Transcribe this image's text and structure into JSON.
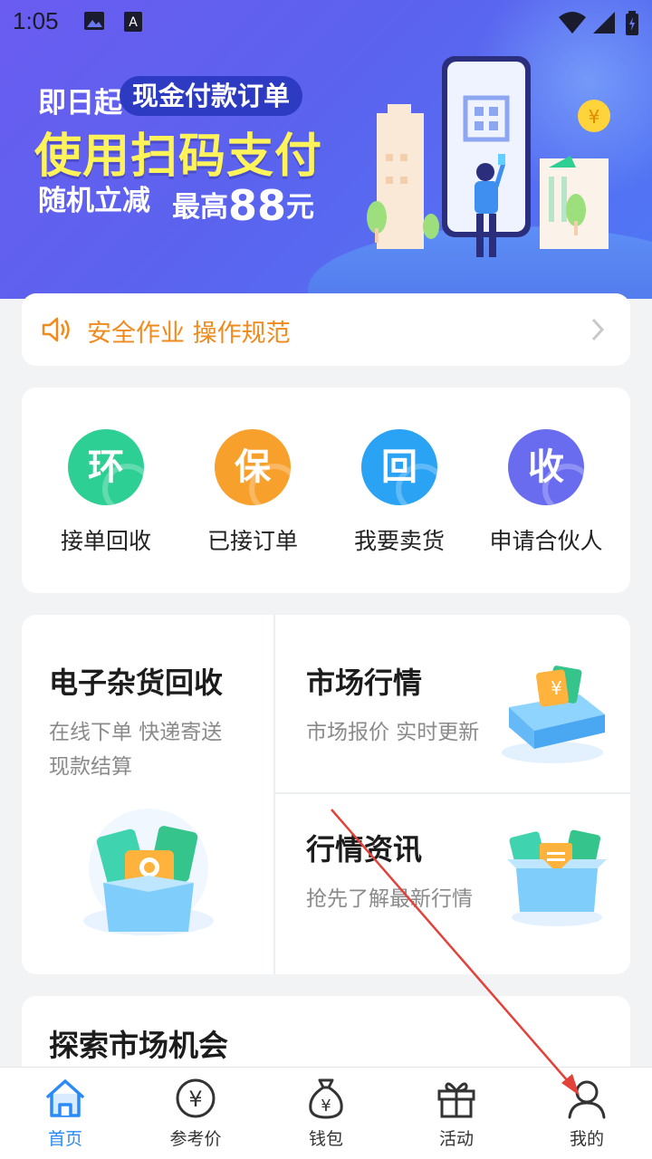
{
  "status_bar": {
    "time": "1:05"
  },
  "banner": {
    "line1": "即日起",
    "pill": "现金付款订单",
    "title": "使用扫码支付",
    "line3": "随机立减",
    "line3b_prefix": "最高",
    "line3b_amount": "88",
    "line3b_suffix": "元"
  },
  "notice": {
    "text": "安全作业 操作规范"
  },
  "quick_menu": [
    {
      "glyph": "环",
      "label": "接单回收",
      "color": "#2ecf95"
    },
    {
      "glyph": "保",
      "label": "已接订单",
      "color": "#f7a02c"
    },
    {
      "glyph": "回",
      "label": "我要卖货",
      "color": "#2aa3f5"
    },
    {
      "glyph": "收",
      "label": "申请合伙人",
      "color": "#6a6cf0"
    }
  ],
  "services": {
    "electronics": {
      "title": "电子杂货回收",
      "sub1": "在线下单 快递寄送",
      "sub2": "现款结算"
    },
    "market": {
      "title": "市场行情",
      "sub": "市场报价 实时更新"
    },
    "news": {
      "title": "行情资讯",
      "sub": "抢先了解最新行情"
    }
  },
  "explore": {
    "title": "探索市场机会"
  },
  "bottom_nav": [
    {
      "label": "首页",
      "icon": "home-icon",
      "active": true
    },
    {
      "label": "参考价",
      "icon": "yuan-circle-icon"
    },
    {
      "label": "钱包",
      "icon": "money-bag-icon"
    },
    {
      "label": "活动",
      "icon": "gift-icon"
    },
    {
      "label": "我的",
      "icon": "user-icon"
    }
  ],
  "colors": {
    "accent": "#2a8af6",
    "notice": "#f08a1c",
    "banner_title": "#fff35a"
  }
}
